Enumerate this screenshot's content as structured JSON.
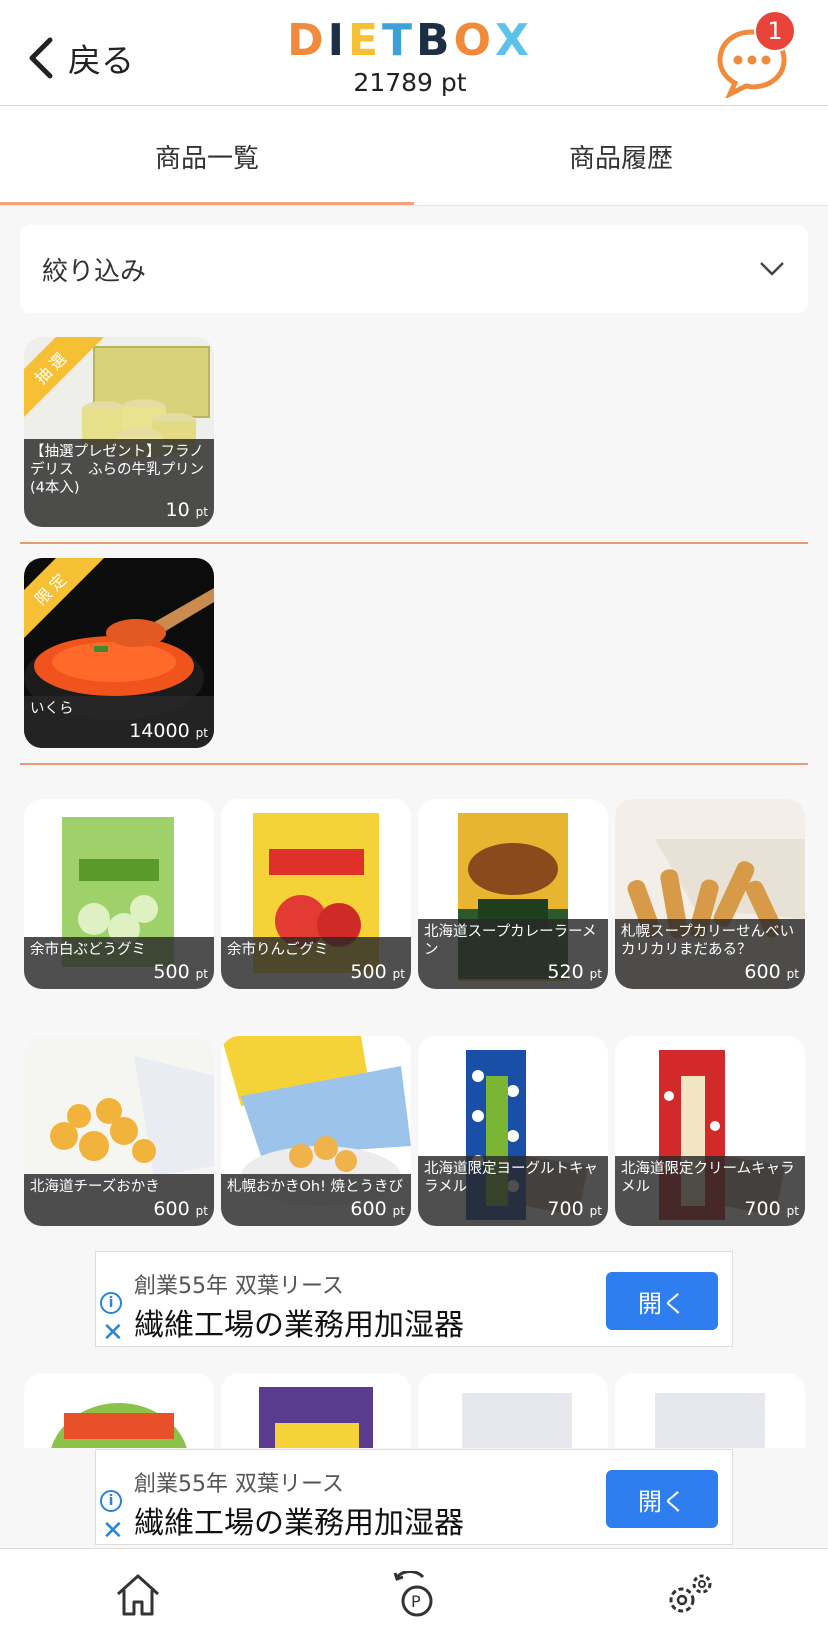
{
  "header": {
    "back_label": "戻る",
    "logo_letters": [
      "D",
      "I",
      "E",
      "T",
      " ",
      "B",
      "O",
      "X"
    ],
    "points": "21789 pt",
    "notification_count": "1"
  },
  "tabs": [
    {
      "label": "商品一覧",
      "active": true
    },
    {
      "label": "商品履歴",
      "active": false
    }
  ],
  "filter": {
    "label": "絞り込み"
  },
  "sections": [
    {
      "items": [
        {
          "ribbon": "抽選",
          "name": "【抽選プレゼント】フラノデリス　ふらの牛乳プリン(4本入)",
          "price": "10",
          "unit": "pt"
        }
      ]
    },
    {
      "items": [
        {
          "ribbon": "限定",
          "name": "いくら",
          "price": "14000",
          "unit": "pt"
        }
      ]
    }
  ],
  "products": [
    {
      "name": "余市白ぶどうグミ",
      "price": "500",
      "unit": "pt"
    },
    {
      "name": "余市りんごグミ",
      "price": "500",
      "unit": "pt"
    },
    {
      "name": "北海道スープカレーラーメン",
      "price": "520",
      "unit": "pt"
    },
    {
      "name": "札幌スープカリーせんべいカリカリまだある？",
      "price": "600",
      "unit": "pt"
    },
    {
      "name": "北海道チーズおかき",
      "price": "600",
      "unit": "pt"
    },
    {
      "name": "札幌おかきOh! 焼とうきび",
      "price": "600",
      "unit": "pt"
    },
    {
      "name": "北海道限定ヨーグルトキャラメル",
      "price": "700",
      "unit": "pt"
    },
    {
      "name": "北海道限定クリームキャラメル",
      "price": "700",
      "unit": "pt"
    }
  ],
  "ads": [
    {
      "sub": "創業55年 双葉リース",
      "main": "繊維工場の業務用加湿器",
      "button": "開く"
    },
    {
      "sub": "創業55年 双葉リース",
      "main": "繊維工場の業務用加湿器",
      "button": "開く"
    }
  ],
  "colors": {
    "accent": "#f2a27a",
    "ribbon": "#f5c033",
    "ad_button": "#2f7ef0",
    "badge": "#e8443a"
  },
  "bottom_nav": [
    "home-icon",
    "point-history-icon",
    "settings-icon"
  ]
}
